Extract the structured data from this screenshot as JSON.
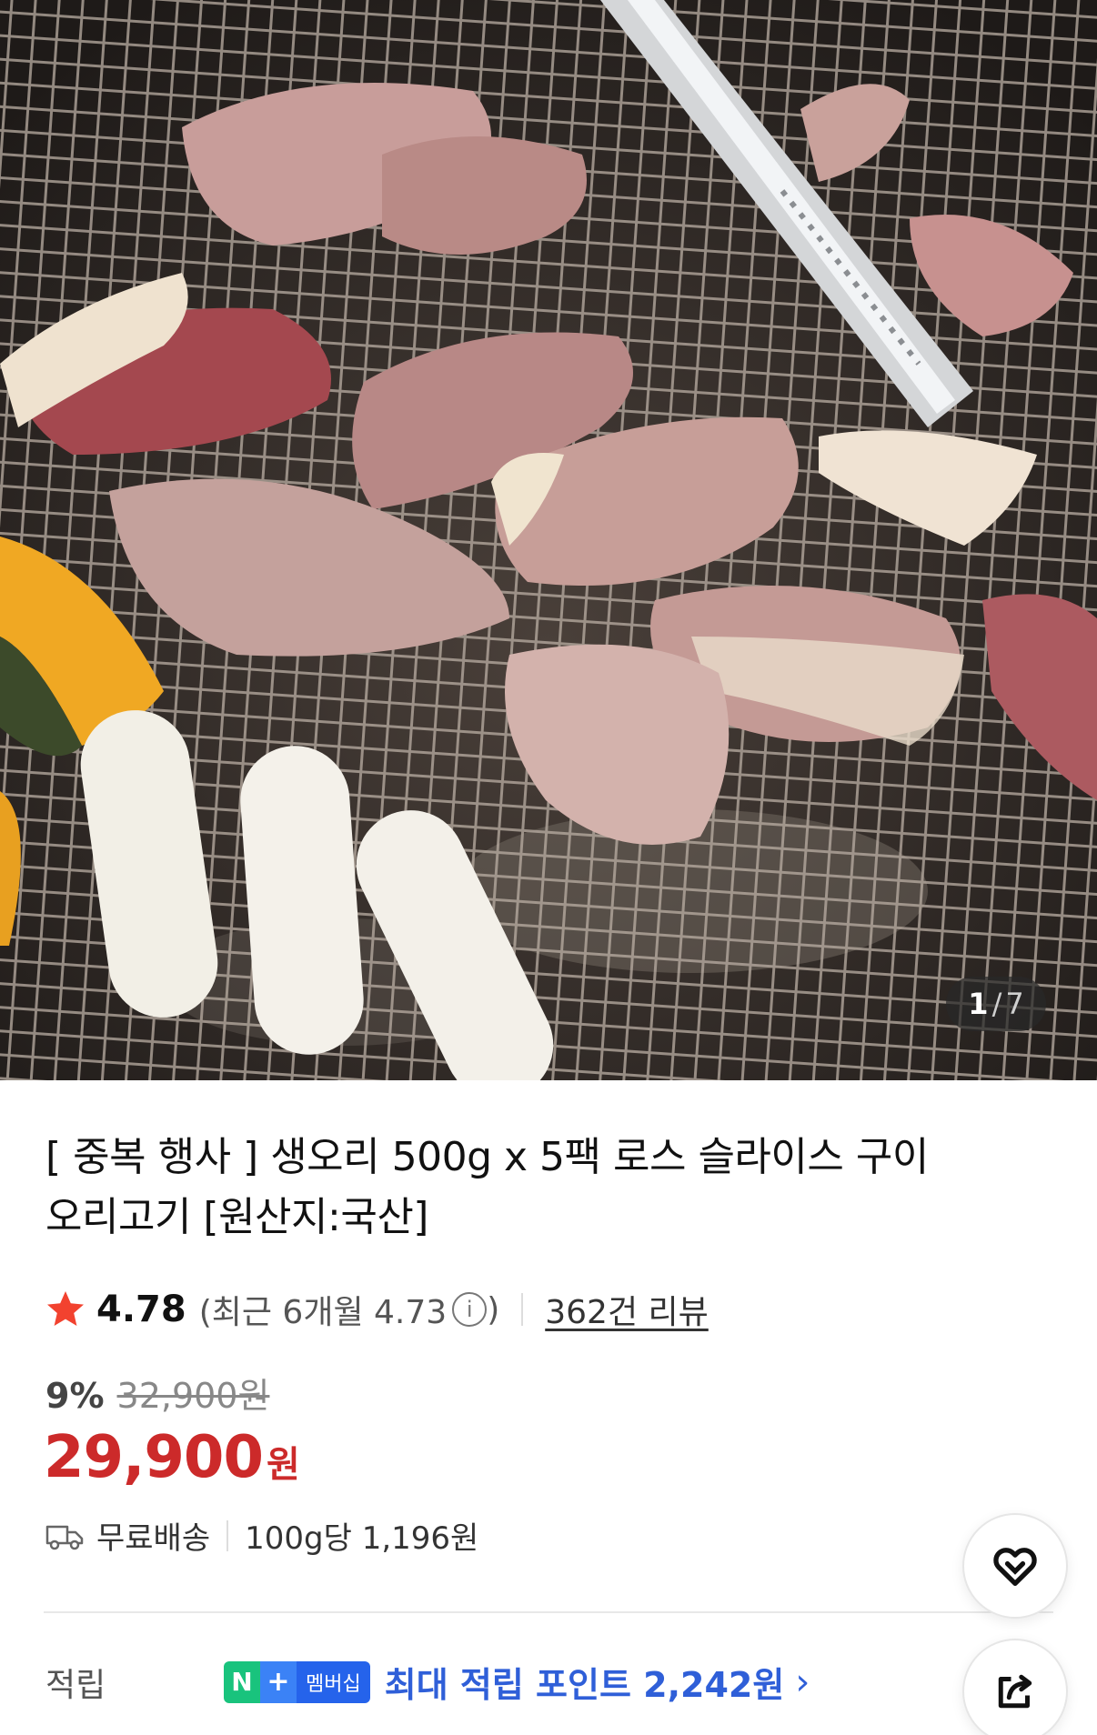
{
  "gallery": {
    "current": "1",
    "separator": "/",
    "total": "7"
  },
  "product": {
    "title": "[ 중복 행사 ] 생오리 500g x 5팩 로스 슬라이스 구이 오리고기 [원산지:국산]"
  },
  "rating": {
    "score": "4.78",
    "recent": "(최근 6개월 4.73",
    "recent_close": ")",
    "info_icon": "i",
    "reviews": "362건 리뷰"
  },
  "price": {
    "discount_pct": "9%",
    "original": "32,900원",
    "sale": "29,900",
    "currency": "원"
  },
  "delivery": {
    "shipping": "무료배송",
    "unit_price": "100g당 1,196원"
  },
  "points": {
    "label": "적립",
    "badge_n": "N",
    "badge_plus": "+",
    "badge_member": "멤버십",
    "text": "최대 적립 포인트 2,242원",
    "chevron": "›"
  },
  "colors": {
    "price_red": "#cc2a2a",
    "star": "#f2422f",
    "points_blue": "#2f5fd8",
    "naver_green": "#19c37d"
  },
  "icons": [
    "star-icon",
    "info-icon",
    "truck-icon",
    "heart-icon",
    "share-icon",
    "chevron-right-icon"
  ]
}
